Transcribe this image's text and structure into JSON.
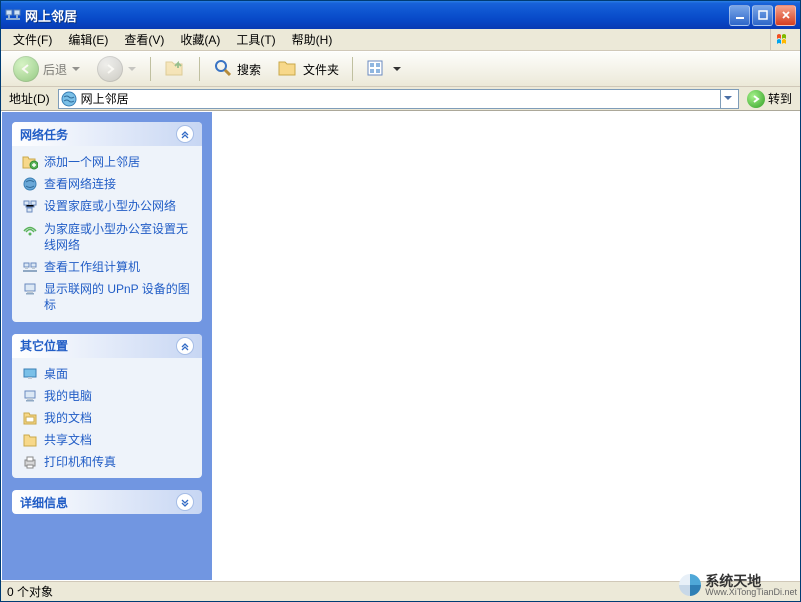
{
  "window": {
    "title": "网上邻居"
  },
  "menu": {
    "file": "文件(F)",
    "edit": "编辑(E)",
    "view": "查看(V)",
    "favorites": "收藏(A)",
    "tools": "工具(T)",
    "help": "帮助(H)"
  },
  "toolbar": {
    "back": "后退",
    "search": "搜索",
    "folders": "文件夹"
  },
  "address": {
    "label": "地址(D)",
    "value": "网上邻居",
    "go": "转到"
  },
  "panels": {
    "network": {
      "title": "网络任务",
      "items": [
        "添加一个网上邻居",
        "查看网络连接",
        "设置家庭或小型办公网络",
        "为家庭或小型办公室设置无线网络",
        "查看工作组计算机",
        "显示联网的 UPnP 设备的图标"
      ]
    },
    "other": {
      "title": "其它位置",
      "items": [
        "桌面",
        "我的电脑",
        "我的文档",
        "共享文档",
        "打印机和传真"
      ]
    },
    "details": {
      "title": "详细信息"
    }
  },
  "status": "0 个对象",
  "watermark": {
    "cn": "系统天地",
    "url": "Www.XiTongTianDi.net"
  }
}
